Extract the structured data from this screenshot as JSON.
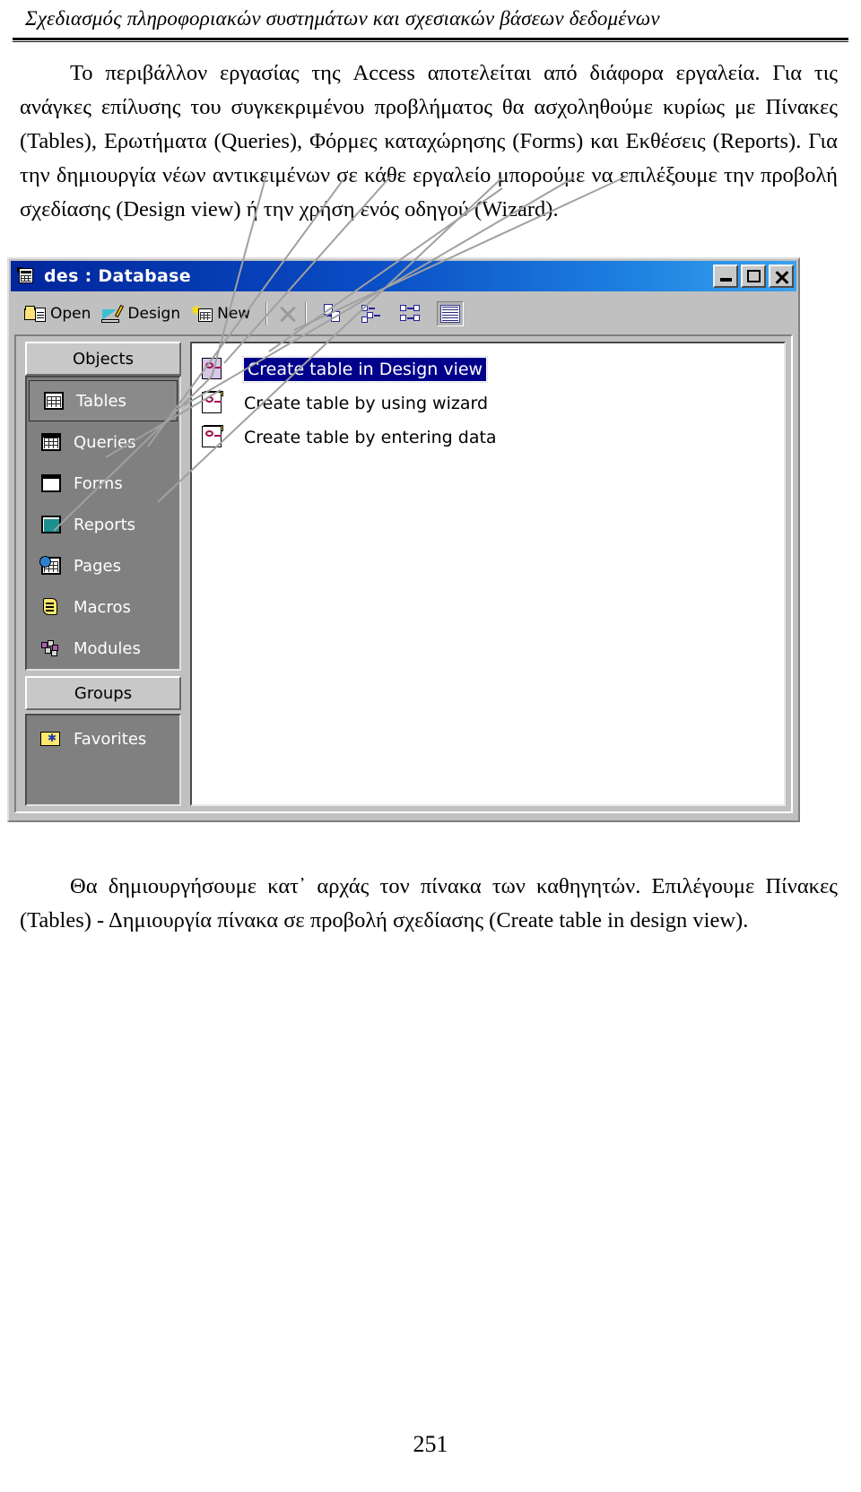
{
  "header": {
    "title": "Σχεδιασμός πληροφοριακών συστημάτων και σχεσιακών βάσεων δεδομένων"
  },
  "body": {
    "paragraph_top": "Το περιβάλλον εργασίας της Access αποτελείται από διάφορα εργαλεία. Για τις ανάγκες επίλυσης του συγκεκριμένου προβλήματος θα ασχοληθούμε κυρίως με Πίνακες (Tables), Ερωτήματα (Queries), Φόρμες καταχώρησης (Forms) και Εκθέσεις (Reports). Για την δημιουργία νέων αντικειμένων σε κάθε εργαλείο μπορούμε να επιλέξουμε την προβολή σχεδίασης (Design view) ή την χρήση ενός οδηγού (Wizard).",
    "paragraph_bottom": "Θα δημιουργήσουμε κατ᾽ αρχάς τον πίνακα των καθηγητών. Επιλέγουμε Πίνακες (Tables) - Δημιουργία πίνακα σε προβολή σχεδίασης (Create table in design view)."
  },
  "access_window": {
    "title": "des : Database",
    "title_icon": "database-icon",
    "window_buttons": [
      {
        "name": "minimize-button",
        "glyph": "_"
      },
      {
        "name": "maximize-button",
        "glyph": "□"
      },
      {
        "name": "close-button",
        "glyph": "✕"
      }
    ],
    "toolbar": {
      "items": [
        {
          "label": "Open",
          "icon": "open-folder-icon",
          "accel": "O"
        },
        {
          "label": "Design",
          "icon": "design-ruler-icon",
          "accel": "D"
        },
        {
          "label": "New",
          "icon": "new-table-icon",
          "accel": "N"
        }
      ],
      "delete_button": {
        "name": "delete-button",
        "icon": "delete-x-icon"
      },
      "view_buttons": [
        {
          "name": "large-icons-view-button",
          "icon": "large-icons-icon",
          "active": false
        },
        {
          "name": "small-icons-view-button",
          "icon": "small-icons-icon",
          "active": false
        },
        {
          "name": "list-view-button",
          "icon": "list-view-icon",
          "active": false
        },
        {
          "name": "details-view-button",
          "icon": "details-view-icon",
          "active": true
        }
      ]
    },
    "objects_panel": {
      "header": "Objects",
      "items": [
        {
          "label": "Tables",
          "icon": "table-icon",
          "selected": true
        },
        {
          "label": "Queries",
          "icon": "query-icon",
          "selected": false
        },
        {
          "label": "Forms",
          "icon": "form-icon",
          "selected": false
        },
        {
          "label": "Reports",
          "icon": "report-icon",
          "selected": false
        },
        {
          "label": "Pages",
          "icon": "page-icon",
          "selected": false
        },
        {
          "label": "Macros",
          "icon": "macro-icon",
          "selected": false
        },
        {
          "label": "Modules",
          "icon": "module-icon",
          "selected": false
        }
      ],
      "groups_header": "Groups",
      "groups": [
        {
          "label": "Favorites",
          "icon": "favorites-folder-icon"
        }
      ]
    },
    "list_items": [
      {
        "label": "Create table in Design view",
        "icon": "design-view-table-icon",
        "selected": true
      },
      {
        "label": "Create table by using wizard",
        "icon": "wizard-table-icon",
        "selected": false
      },
      {
        "label": "Create table by entering data",
        "icon": "datasheet-table-icon",
        "selected": false
      }
    ]
  },
  "footer": {
    "page_number": "251"
  },
  "colors": {
    "titlebar_start": "#00259c",
    "titlebar_end": "#3aa3ef",
    "window_face": "#c0c0c0",
    "panel_face": "#808080",
    "selection": "#00008b",
    "annotation_line": "#a0a0a0"
  }
}
